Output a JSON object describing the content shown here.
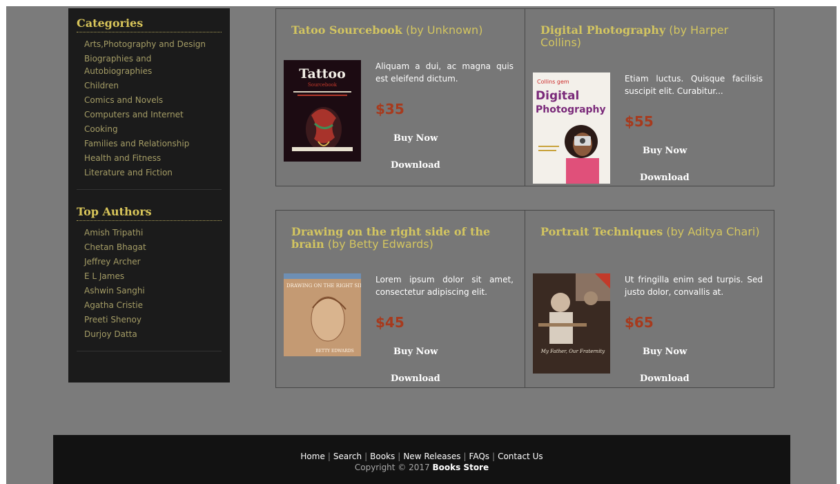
{
  "sidebar": {
    "categories_title": "Categories",
    "categories": [
      "Arts,Photography and Design",
      "Biographies and Autobiographies",
      "Children",
      "Comics and Novels",
      "Computers and Internet",
      "Cooking",
      "Families and Relationship",
      "Health and Fitness",
      "Literature and Fiction"
    ],
    "authors_title": "Top Authors",
    "authors": [
      "Amish Tripathi",
      "Chetan Bhagat",
      "Jeffrey Archer",
      "E L James",
      "Ashwin Sanghi",
      "Agatha Cristie",
      "Preeti Shenoy",
      "Durjoy Datta"
    ]
  },
  "products": [
    {
      "title": "Tatoo Sourcebook",
      "author": "(by Unknown)",
      "description": "Aliquam a dui, ac magna quis est eleifend dictum.",
      "price": "$35",
      "buy_label": "Buy Now",
      "download_label": "Download",
      "cover_title": "Tattoo",
      "cover_sub": "Sourcebook"
    },
    {
      "title": "Digital Photography",
      "author": "(by Harper Collins)",
      "description": "Etiam luctus. Quisque facilisis suscipit elit. Curabitur...",
      "price": "$55",
      "buy_label": "Buy Now",
      "download_label": "Download",
      "cover_brand": "Collins gem",
      "cover_title1": "Digital",
      "cover_title2": "Photography"
    },
    {
      "title": "Drawing on the right side of the brain",
      "author": "(by Betty Edwards)",
      "description": "Lorem ipsum dolor sit amet, consectetur adipiscing elit.",
      "price": "$45",
      "buy_label": "Buy Now",
      "download_label": "Download",
      "cover_title": "DRAWING ON THE RIGHT SIDE OF THE BRAIN",
      "cover_author": "BETTY EDWARDS"
    },
    {
      "title": "Portrait Techniques",
      "author": "(by Aditya Chari)",
      "description": "Ut fringilla enim sed turpis. Sed justo dolor, convallis at.",
      "price": "$65",
      "buy_label": "Buy Now",
      "download_label": "Download",
      "cover_title": "My Father, Our Fraternity"
    }
  ],
  "footer": {
    "links": [
      "Home",
      "Search",
      "Books",
      "New Releases",
      "FAQs",
      "Contact Us"
    ],
    "copyright_prefix": "Copyright © 2017",
    "brand": "Books Store"
  },
  "colors": {
    "page_bg": "#7b7b7b",
    "sidebar_bg": "#1b1b1b",
    "heading": "#d8c55a",
    "link": "#a59d66",
    "title": "#d3c560",
    "price": "#a73a1d",
    "footer_bg": "#121212"
  }
}
